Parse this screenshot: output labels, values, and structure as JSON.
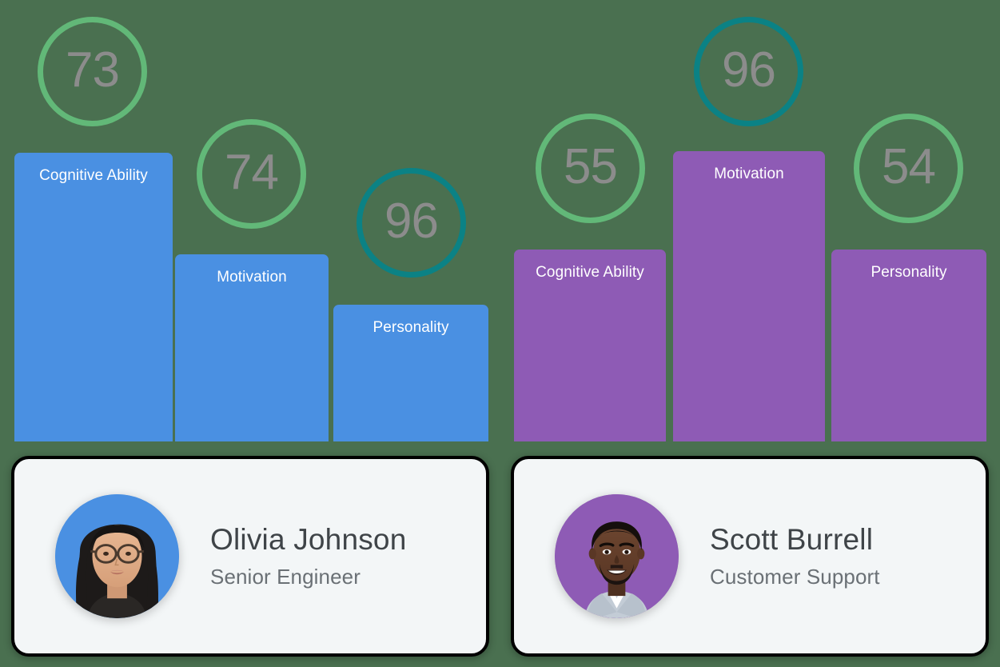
{
  "theme": {
    "background": "#4a7050",
    "bar_blue": "#4a90e2",
    "bar_purple": "#8e5bb5",
    "ring_green": "#62b878",
    "ring_teal": "#0b8285",
    "score_text": "#8c8c8c",
    "bar_label_text": "#ffffff",
    "card_background": "#f3f6f7",
    "card_border": "#000000",
    "name_text": "#3f4448",
    "role_text": "#6a7075"
  },
  "chart_data": {
    "type": "bar",
    "title": "",
    "xlabel": "",
    "ylabel": "",
    "grid": false,
    "legend": "none",
    "ylim": [
      0,
      100
    ],
    "categories": [
      "Cognitive Ability",
      "Motivation",
      "Personality"
    ],
    "series": [
      {
        "name": "Olivia Johnson",
        "color": "#4a90e2",
        "values": [
          73,
          74,
          96
        ]
      },
      {
        "name": "Scott Burrell",
        "color": "#8e5bb5",
        "values": [
          55,
          96,
          54
        ]
      }
    ]
  },
  "panels": [
    {
      "id": "olivia",
      "bar_color": "#4a90e2",
      "bars": [
        {
          "label": "Cognitive Ability",
          "score": "73",
          "ring_color": "#62b878"
        },
        {
          "label": "Motivation",
          "score": "74",
          "ring_color": "#62b878"
        },
        {
          "label": "Personality",
          "score": "96",
          "ring_color": "#0b8285"
        }
      ],
      "person": {
        "name": "Olivia Johnson",
        "role": "Senior Engineer",
        "avatar_bg": "#4a90e2",
        "avatar_name": "avatar-olivia-johnson"
      }
    },
    {
      "id": "scott",
      "bar_color": "#8e5bb5",
      "bars": [
        {
          "label": "Cognitive Ability",
          "score": "55",
          "ring_color": "#62b878"
        },
        {
          "label": "Motivation",
          "score": "96",
          "ring_color": "#0b8285"
        },
        {
          "label": "Personality",
          "score": "54",
          "ring_color": "#62b878"
        }
      ],
      "person": {
        "name": "Scott Burrell",
        "role": "Customer Support",
        "avatar_bg": "#8e5bb5",
        "avatar_name": "avatar-scott-burrell"
      }
    }
  ]
}
